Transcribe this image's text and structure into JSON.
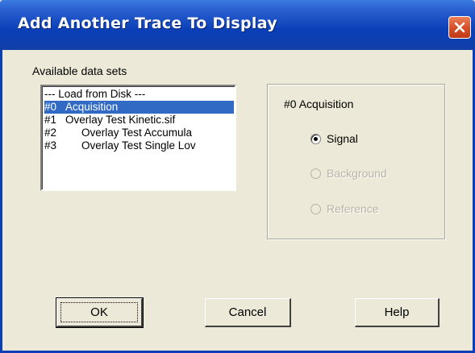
{
  "window": {
    "title": "Add Another Trace To Display"
  },
  "datasets": {
    "label": "Available data sets",
    "items": [
      {
        "num": "",
        "name": "--- Load from Disk ---",
        "selected": false
      },
      {
        "num": "#0",
        "name": "Acquisition",
        "selected": true
      },
      {
        "num": "#1",
        "name": "Overlay Test Kinetic.sif",
        "selected": false
      },
      {
        "num": "#2",
        "name": "Overlay Test Accumula",
        "selected": false
      },
      {
        "num": "#3",
        "name": "Overlay Test Single Lov",
        "selected": false
      }
    ]
  },
  "selection": {
    "title": "#0  Acquisition",
    "options": [
      {
        "label": "Signal",
        "checked": true,
        "enabled": true
      },
      {
        "label": "Background",
        "checked": false,
        "enabled": false
      },
      {
        "label": "Reference",
        "checked": false,
        "enabled": false
      }
    ]
  },
  "buttons": {
    "ok": "OK",
    "cancel": "Cancel",
    "help": "Help"
  },
  "colors": {
    "title_bar": "#0a3fb8",
    "selection": "#316ac5",
    "face": "#ece9d8"
  }
}
